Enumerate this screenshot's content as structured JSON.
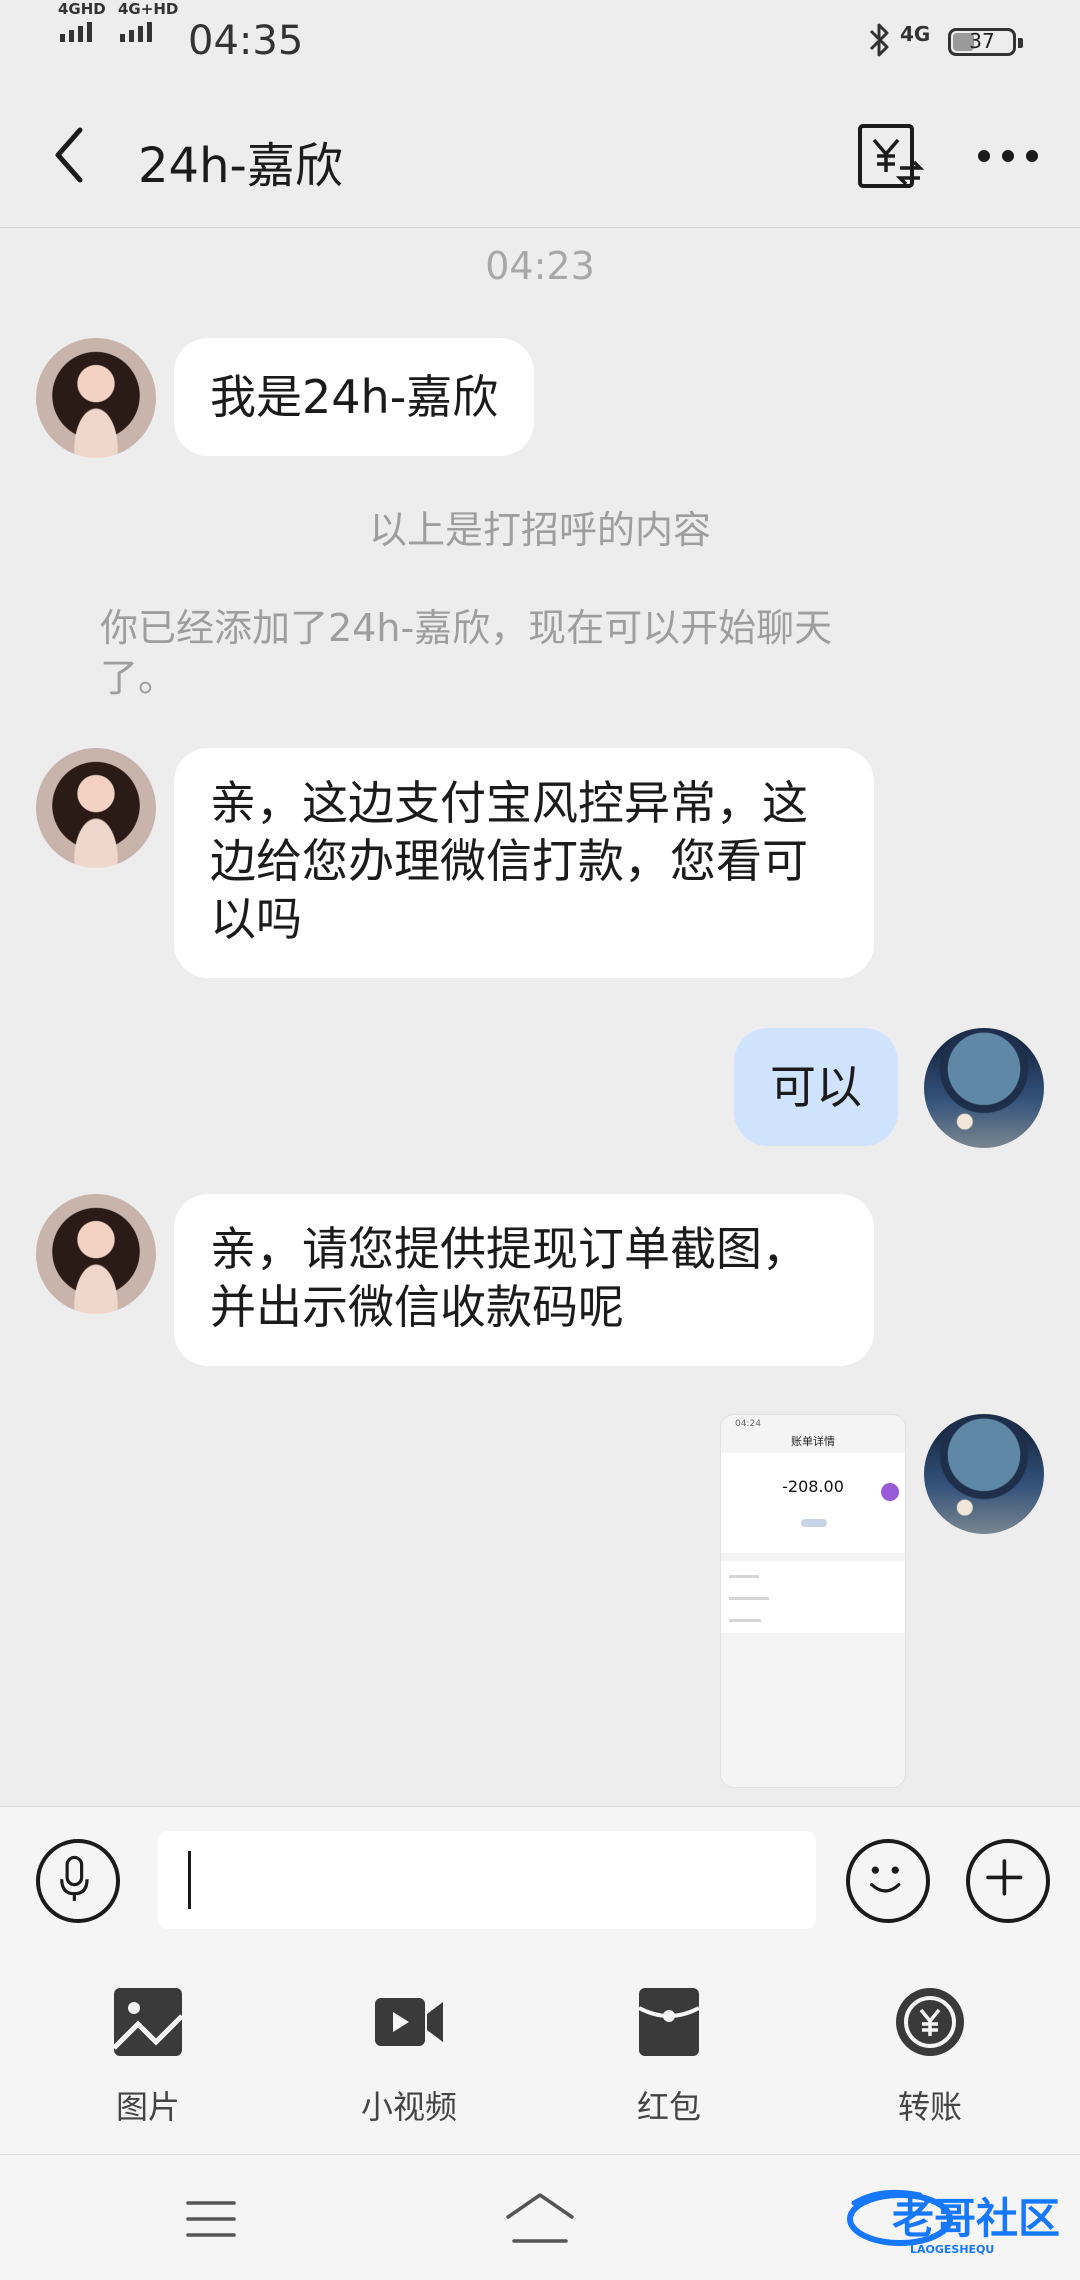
{
  "status_bar": {
    "signal_1": "4GHD",
    "signal_2": "4G+HD",
    "time": "04:35",
    "network": "4G",
    "battery": "37",
    "battery_level": 0.37
  },
  "header": {
    "title": "24h-嘉欣",
    "transfer_icon": "yuan-transfer-icon",
    "more_icon": "more-icon"
  },
  "chat": {
    "timestamp": "04:23",
    "greeting": "我是24h-嘉欣",
    "greeting_note": "以上是打招呼的内容",
    "added_note_line1": "你已经添加了24h-嘉欣，现在可以开始聊天",
    "added_note_line2": "了。",
    "msg1": "亲，这边支付宝风控异常，这边给您办理微信打款，您看可以吗",
    "msg2": "可以",
    "msg3": "亲，请您提供提现订单截图，并出示微信收款码呢"
  },
  "screenshot_preview": {
    "status_time": "04:24",
    "title": "账单详情",
    "amount": "-208.00"
  },
  "input": {
    "value": "",
    "placeholder": ""
  },
  "tools": {
    "image": "图片",
    "video": "小视频",
    "red_packet": "红包",
    "transfer": "转账"
  },
  "watermark": "老哥社区",
  "watermark_sub": "LAOGESHEQU",
  "colors": {
    "background": "#ededed",
    "incoming_bubble": "#ffffff",
    "outgoing_bubble": "#cfe3ff",
    "watermark_blue": "#1677ff"
  }
}
